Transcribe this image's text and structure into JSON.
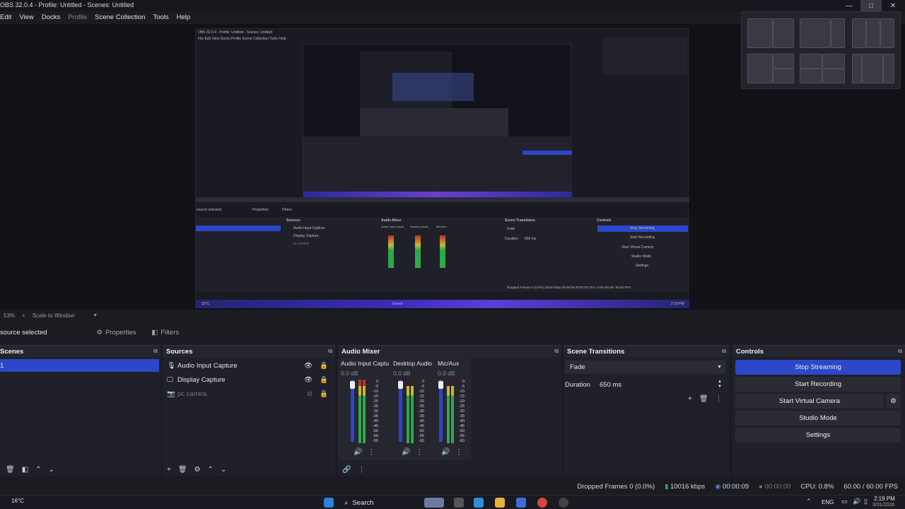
{
  "window": {
    "title": "OBS 32.0.4 - Profile: Untitled - Scenes: Untitled",
    "minimize": "—",
    "maximize": "□",
    "close": "✕"
  },
  "menu": [
    "Edit",
    "View",
    "Docks",
    "Profile",
    "Scene Collection",
    "Tools",
    "Help"
  ],
  "preview": {
    "nested_title": "OBS 32.0.4 - Profile: Untitled - Scenes: Untitled",
    "nested_menu": "File  Edit  View  Docks  Profile  Scene Collection  Tools  Help",
    "nested_no_source": "source selected",
    "nested_properties": "Properties",
    "nested_filters": "Filters",
    "nested_sources_hd": "Sources",
    "nested_mixer_hd": "Audio Mixer",
    "nested_transitions_hd": "Scene Transitions",
    "nested_controls_hd": "Controls",
    "nested_src": [
      "Audio Input Capture",
      "Display Capture",
      "pc camira"
    ],
    "nested_channels": [
      "Audio Input Captu",
      "Desktop Audio",
      "Mic/Aux"
    ],
    "nested_fade": "Fade",
    "nested_duration": "Duration",
    "nested_ms": "650 ms",
    "nested_controls": [
      "Stop Streaming",
      "Start Recording",
      "Start Virtual Camera",
      "Studio Mode",
      "Settings"
    ],
    "nested_status": "Dropped Frames 0 (0.0%)   10016 kbps   00:00:09   00:00:00   CPU: 0.8%   60.00 / 60.00 FPS",
    "nested_weather": "16°C",
    "nested_search": "Search",
    "nested_clock": "2:19 PM"
  },
  "zoom": {
    "percent": "53%",
    "mode": "Scale to Window"
  },
  "context": {
    "no_source": "source selected",
    "properties": "Properties",
    "filters": "Filters"
  },
  "scenes": {
    "title": "Scenes",
    "items": [
      "1"
    ]
  },
  "sources": {
    "title": "Sources",
    "items": [
      {
        "icon": "mic-icon",
        "label": "Audio Input Capture",
        "dim": false
      },
      {
        "icon": "monitor-icon",
        "label": "Display Capture",
        "dim": false
      },
      {
        "icon": "camera-icon",
        "label": "pc camira",
        "dim": true
      }
    ]
  },
  "mixer": {
    "title": "Audio Mixer",
    "channels": [
      {
        "name": "Audio Input Captu",
        "db": "0.0 dB"
      },
      {
        "name": "Desktop Audio",
        "db": "0.0 dB"
      },
      {
        "name": "Mic/Aux",
        "db": "0.0 dB"
      }
    ],
    "scale": [
      "0",
      "-5",
      "-10",
      "-15",
      "-20",
      "-25",
      "-30",
      "-35",
      "-40",
      "-45",
      "-50",
      "-55",
      "-60"
    ]
  },
  "transitions": {
    "title": "Scene Transitions",
    "selected": "Fade",
    "duration_label": "Duration",
    "duration_value": "650 ms"
  },
  "controls": {
    "title": "Controls",
    "stop_streaming": "Stop Streaming",
    "start_recording": "Start Recording",
    "start_virtual_camera": "Start Virtual Camera",
    "studio_mode": "Studio Mode",
    "settings": "Settings"
  },
  "status": {
    "dropped": "Dropped Frames 0 (0.0%)",
    "kbps": "10016 kbps",
    "stream_time": "00:00:09",
    "rec_time": "00:00:00",
    "cpu": "CPU: 0.8%",
    "fps": "60.00 / 60.00 FPS"
  },
  "taskbar": {
    "weather": "16°C",
    "search": "Search",
    "lang": "ENG",
    "time": "2:19 PM",
    "date": "3/31/2026"
  },
  "colors": {
    "accent": "#2c47c9",
    "meter_green": "#2fa84a",
    "meter_yellow": "#c9b92f",
    "meter_red": "#b8332f"
  }
}
